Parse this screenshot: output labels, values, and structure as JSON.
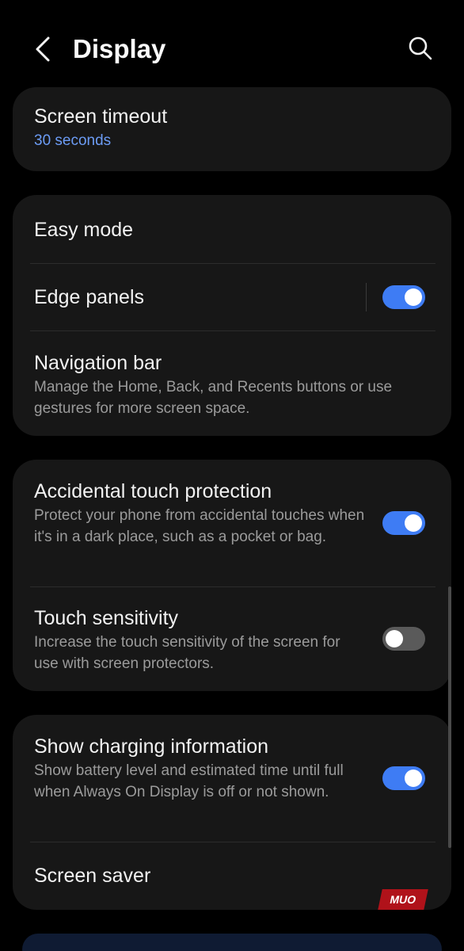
{
  "header": {
    "title": "Display",
    "back_icon": "back-arrow-icon",
    "search_icon": "search-icon"
  },
  "screen_timeout": {
    "title": "Screen timeout",
    "value": "30 seconds"
  },
  "group1": {
    "easy_mode": {
      "title": "Easy mode"
    },
    "edge_panels": {
      "title": "Edge panels",
      "toggle_on": true
    },
    "navigation_bar": {
      "title": "Navigation bar",
      "subtitle": "Manage the Home, Back, and Recents buttons or use gestures for more screen space."
    }
  },
  "group2": {
    "accidental_touch": {
      "title": "Accidental touch protection",
      "subtitle": "Protect your phone from accidental touches when it's in a dark place, such as a pocket or bag.",
      "toggle_on": true
    },
    "touch_sensitivity": {
      "title": "Touch sensitivity",
      "subtitle": "Increase the touch sensitivity of the screen for use with screen protectors.",
      "toggle_on": false
    }
  },
  "group3": {
    "charging_info": {
      "title": "Show charging information",
      "subtitle": "Show battery level and estimated time until full when Always On Display is off or not shown.",
      "toggle_on": true
    },
    "screen_saver": {
      "title": "Screen saver"
    }
  },
  "watermark": {
    "text": "MUO"
  },
  "colors": {
    "background": "#000000",
    "card": "#171717",
    "accent_toggle": "#3e7cf4",
    "value_text": "#6c9cf5",
    "subtitle_text": "#9b9b9b"
  }
}
